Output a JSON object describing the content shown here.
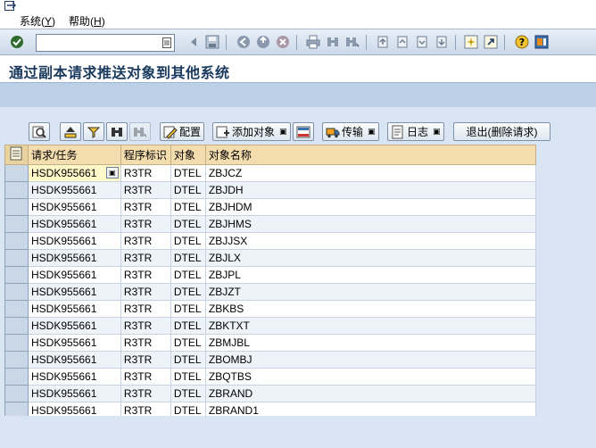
{
  "menu": {
    "system_label": "系统(Y)",
    "system_text": "系统",
    "system_key": "Y",
    "help_text": "帮助",
    "help_key": "H"
  },
  "toolbar": {
    "command_value": "",
    "icons": [
      "check-icon",
      "back-icon",
      "save-icon",
      "nav-back-icon",
      "nav-exit-icon",
      "nav-cancel-icon",
      "print-icon",
      "find-icon",
      "find-next-icon",
      "first-page-icon",
      "prev-page-icon",
      "next-page-icon",
      "last-page-icon",
      "create-session-icon",
      "shortcut-icon",
      "help-icon",
      "layout-icon"
    ]
  },
  "title": "通过副本请求推送对象到其他系统",
  "alv_toolbar": {
    "config_label": "配置",
    "add_object_label": "添加对象",
    "transport_label": "传输",
    "log_label": "日志",
    "exit_label": "退出(删除请求)"
  },
  "grid": {
    "columns": [
      "请求/任务",
      "程序标识",
      "对象",
      "对象名称"
    ],
    "rows": [
      [
        "HSDK955661",
        "R3TR",
        "DTEL",
        "ZBJCZ"
      ],
      [
        "HSDK955661",
        "R3TR",
        "DTEL",
        "ZBJDH"
      ],
      [
        "HSDK955661",
        "R3TR",
        "DTEL",
        "ZBJHDM"
      ],
      [
        "HSDK955661",
        "R3TR",
        "DTEL",
        "ZBJHMS"
      ],
      [
        "HSDK955661",
        "R3TR",
        "DTEL",
        "ZBJJSX"
      ],
      [
        "HSDK955661",
        "R3TR",
        "DTEL",
        "ZBJLX"
      ],
      [
        "HSDK955661",
        "R3TR",
        "DTEL",
        "ZBJPL"
      ],
      [
        "HSDK955661",
        "R3TR",
        "DTEL",
        "ZBJZT"
      ],
      [
        "HSDK955661",
        "R3TR",
        "DTEL",
        "ZBKBS"
      ],
      [
        "HSDK955661",
        "R3TR",
        "DTEL",
        "ZBKTXT"
      ],
      [
        "HSDK955661",
        "R3TR",
        "DTEL",
        "ZBMJBL"
      ],
      [
        "HSDK955661",
        "R3TR",
        "DTEL",
        "ZBOMBJ"
      ],
      [
        "HSDK955661",
        "R3TR",
        "DTEL",
        "ZBQTBS"
      ],
      [
        "HSDK955661",
        "R3TR",
        "DTEL",
        "ZBRAND"
      ],
      [
        "HSDK955661",
        "R3TR",
        "DTEL",
        "ZBRAND1"
      ]
    ]
  },
  "colors": {
    "header_bg": "#f3dcae",
    "focus_cell": "#fff8c8",
    "title_text": "#1a3a5e",
    "band": "#bcd0e6"
  }
}
